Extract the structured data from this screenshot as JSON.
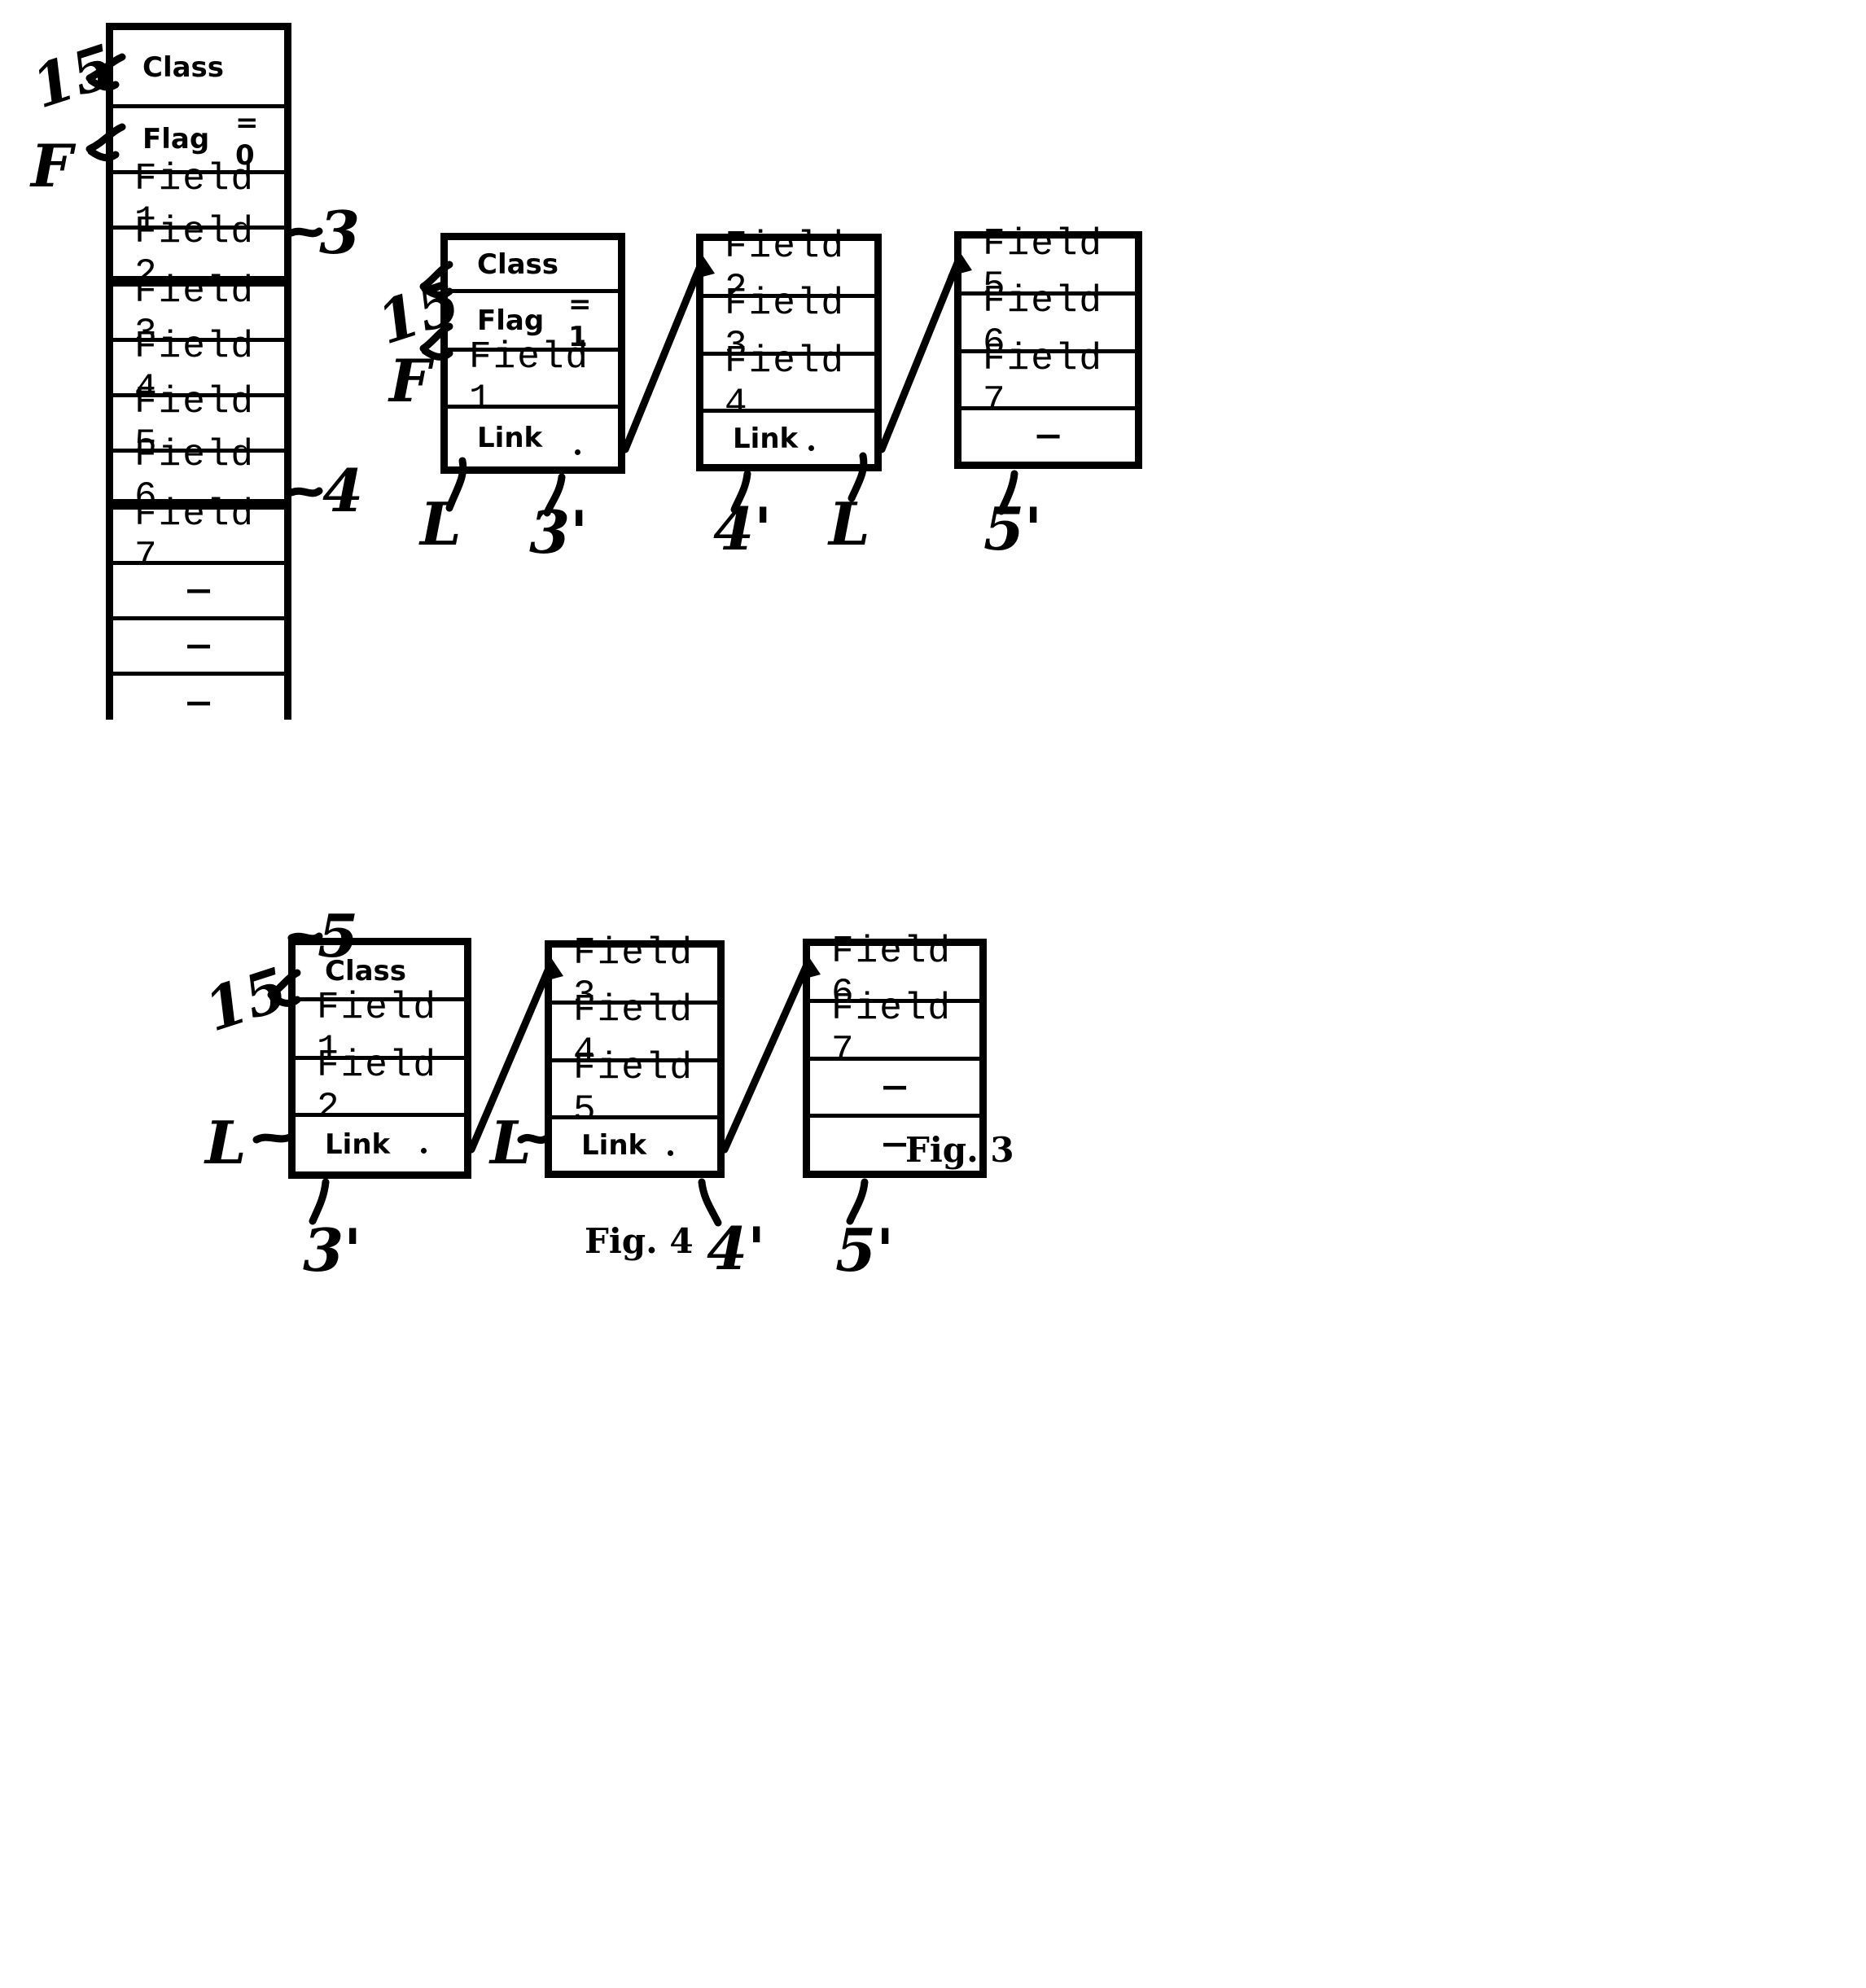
{
  "figures": [
    {
      "id": "fig3",
      "caption": "Fig. 3",
      "blocks": [
        {
          "id": "fig3-unsegmented-block",
          "ref": "3",
          "rows": [
            {
              "label": "Class",
              "style": "bold"
            },
            {
              "label": "Flag",
              "style": "bold",
              "value": "= 0"
            },
            {
              "label": "Field 1",
              "style": "mono"
            },
            {
              "label": "Field 2",
              "style": "mono"
            },
            {
              "label": "Field 3",
              "style": "mono"
            },
            {
              "label": "Field 4",
              "style": "mono"
            },
            {
              "label": "Field 5",
              "style": "mono"
            },
            {
              "label": "Field 6",
              "style": "mono"
            },
            {
              "label": "Field 7",
              "style": "mono"
            },
            {
              "label": "—",
              "style": "dash"
            },
            {
              "label": "—",
              "style": "dash"
            },
            {
              "label": "—",
              "style": "dash"
            }
          ]
        },
        {
          "id": "fig3-head-block",
          "ref": "3'",
          "rows": [
            {
              "label": "Class",
              "style": "bold"
            },
            {
              "label": "Flag",
              "style": "bold",
              "value": "= 1"
            },
            {
              "label": "Field 1",
              "style": "mono"
            },
            {
              "label": "Link",
              "style": "bold"
            }
          ]
        },
        {
          "id": "fig3-second-block",
          "ref": "4'",
          "rows": [
            {
              "label": "Field 2",
              "style": "mono"
            },
            {
              "label": "Field 3",
              "style": "mono"
            },
            {
              "label": "Field 4",
              "style": "mono"
            },
            {
              "label": "Link",
              "style": "bold"
            }
          ]
        },
        {
          "id": "fig3-third-block",
          "ref": "5'",
          "rows": [
            {
              "label": "Field 5",
              "style": "mono"
            },
            {
              "label": "Field 6",
              "style": "mono"
            },
            {
              "label": "Field 7",
              "style": "mono"
            },
            {
              "label": "—",
              "style": "dash"
            }
          ]
        }
      ],
      "annotations": [
        {
          "text": "15",
          "role": "class-field-marker"
        },
        {
          "text": "F",
          "role": "flag-field-marker"
        },
        {
          "text": "3",
          "role": "segment-3-marker"
        },
        {
          "text": "4",
          "role": "segment-4-marker"
        },
        {
          "text": "5",
          "role": "segment-5-marker"
        },
        {
          "text": "15",
          "role": "class-field-marker"
        },
        {
          "text": "F",
          "role": "flag-field-marker"
        },
        {
          "text": "L",
          "role": "link-field-marker"
        },
        {
          "text": "3'",
          "role": "block-3prime-marker"
        },
        {
          "text": "4'",
          "role": "block-4prime-marker"
        },
        {
          "text": "L",
          "role": "link-field-marker"
        },
        {
          "text": "5'",
          "role": "block-5prime-marker"
        }
      ]
    },
    {
      "id": "fig4",
      "caption": "Fig. 4",
      "blocks": [
        {
          "id": "fig4-head-block",
          "ref": "3'",
          "rows": [
            {
              "label": "Class",
              "style": "bold"
            },
            {
              "label": "Field 1",
              "style": "mono"
            },
            {
              "label": "Field 2",
              "style": "mono"
            },
            {
              "label": "Link",
              "style": "bold"
            }
          ]
        },
        {
          "id": "fig4-second-block",
          "ref": "4'",
          "rows": [
            {
              "label": "Field 3",
              "style": "mono"
            },
            {
              "label": "Field 4",
              "style": "mono"
            },
            {
              "label": "Field 5",
              "style": "mono"
            },
            {
              "label": "Link",
              "style": "bold"
            }
          ]
        },
        {
          "id": "fig4-third-block",
          "ref": "5'",
          "rows": [
            {
              "label": "Field 6",
              "style": "mono"
            },
            {
              "label": "Field 7",
              "style": "mono"
            },
            {
              "label": "—",
              "style": "dash"
            },
            {
              "label": "—",
              "style": "dash"
            }
          ]
        }
      ],
      "annotations": [
        {
          "text": "15",
          "role": "class-field-marker"
        },
        {
          "text": "L",
          "role": "link-field-marker"
        },
        {
          "text": "3'",
          "role": "block-3prime-marker"
        },
        {
          "text": "L",
          "role": "link-field-marker"
        },
        {
          "text": "4'",
          "role": "block-4prime-marker"
        },
        {
          "text": "5'",
          "role": "block-5prime-marker"
        }
      ]
    }
  ],
  "labels": {
    "class": "Class",
    "flag": "Flag",
    "flag_value_zero": "= 0",
    "flag_value_one": "= 1",
    "link": "Link",
    "field_1": "Field 1",
    "field_2": "Field 2",
    "field_3": "Field 3",
    "field_4": "Field 4",
    "field_5": "Field 5",
    "field_6": "Field 6",
    "field_7": "Field 7",
    "empty": "—",
    "ref_15": "15",
    "ref_F": "F",
    "ref_L": "L",
    "ref_3": "3",
    "ref_4": "4",
    "ref_5": "5",
    "ref_3p": "3'",
    "ref_4p": "4'",
    "ref_5p": "5'",
    "fig3_caption": "Fig. 3",
    "fig4_caption": "Fig. 4"
  },
  "colors": {
    "ink": "#000000",
    "paper": "#ffffff"
  }
}
